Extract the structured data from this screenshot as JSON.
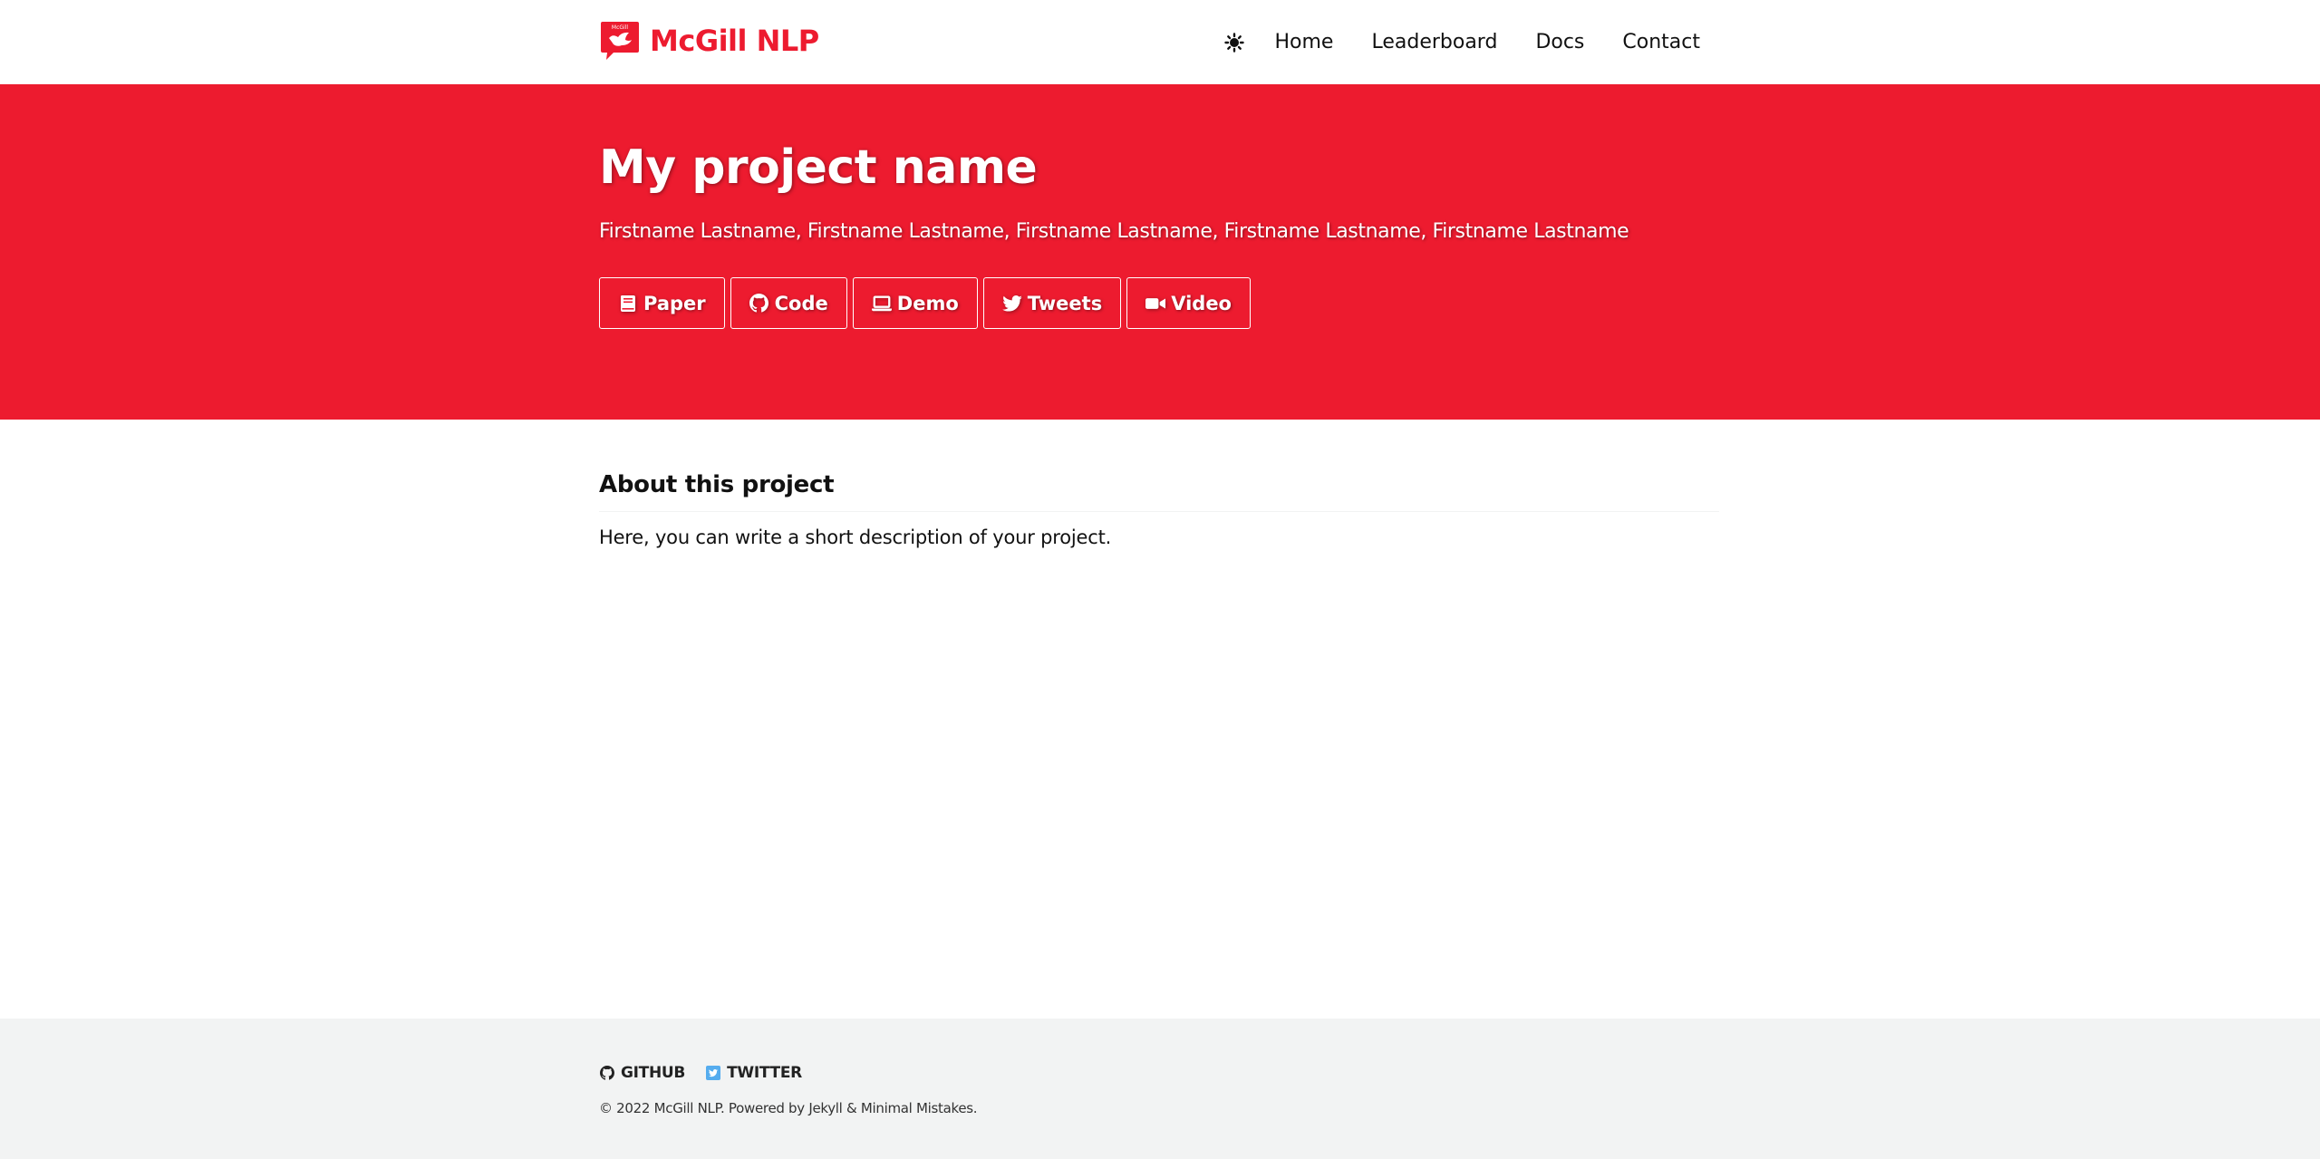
{
  "header": {
    "site_title": "McGill NLP",
    "logo_badge_text": "McGill",
    "nav": {
      "items": [
        {
          "label": "Home"
        },
        {
          "label": "Leaderboard"
        },
        {
          "label": "Docs"
        },
        {
          "label": "Contact"
        }
      ]
    }
  },
  "hero": {
    "title": "My project name",
    "authors": "Firstname Lastname, Firstname Lastname, Firstname Lastname, Firstname Lastname, Firstname Lastname",
    "buttons": [
      {
        "label": "Paper",
        "icon": "book-icon"
      },
      {
        "label": "Code",
        "icon": "github-icon"
      },
      {
        "label": "Demo",
        "icon": "laptop-icon"
      },
      {
        "label": "Tweets",
        "icon": "twitter-icon"
      },
      {
        "label": "Video",
        "icon": "video-camera-icon"
      }
    ]
  },
  "main": {
    "section_title": "About this project",
    "description": "Here, you can write a short description of your project."
  },
  "footer": {
    "links": [
      {
        "label": "GITHUB",
        "icon": "github-icon"
      },
      {
        "label": "TWITTER",
        "icon": "twitter-square-icon"
      }
    ],
    "copyright": "© 2022 McGill NLP. Powered by Jekyll & Minimal Mistakes."
  },
  "colors": {
    "brand_red": "#ed1b2f",
    "footer_bg": "#f2f3f3",
    "twitter_blue": "#55acee",
    "text": "#111111"
  }
}
